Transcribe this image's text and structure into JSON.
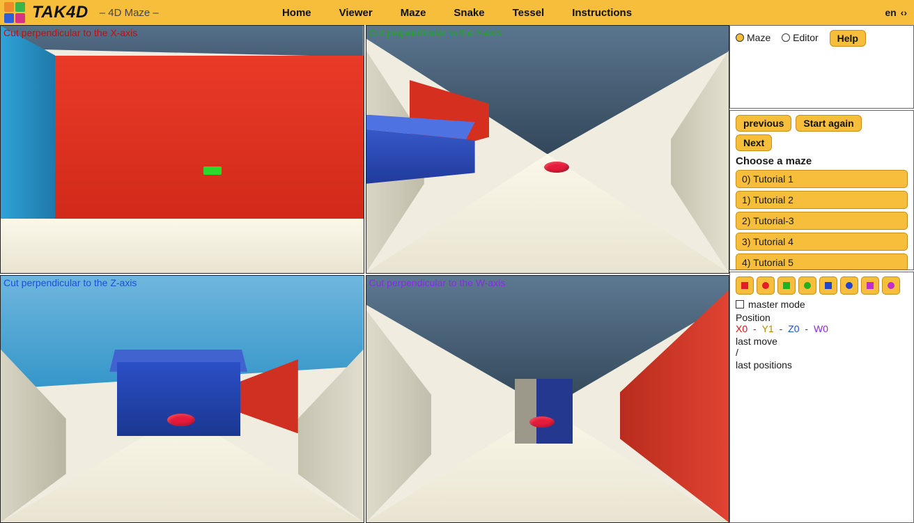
{
  "brand": "TAK4D",
  "subtitle": "– 4D Maze –",
  "nav": {
    "home": "Home",
    "viewer": "Viewer",
    "maze": "Maze",
    "snake": "Snake",
    "tessel": "Tessel",
    "instructions": "Instructions"
  },
  "lang": {
    "label": "en",
    "icon": "‹›"
  },
  "panes": {
    "x": "Cut perpendicular to the X-axis",
    "y": "Cut perpendicular to the Y-axis",
    "z": "Cut perpendicular to the Z-axis",
    "w": "Cut perpendicular to the W-axis"
  },
  "panel_top": {
    "mode_maze": "Maze",
    "mode_editor": "Editor",
    "help": "Help"
  },
  "panel_mid": {
    "previous": "previous",
    "start_again": "Start again",
    "next": "Next",
    "choose": "Choose a maze",
    "items": {
      "0": "0) Tutorial 1",
      "1": "1) Tutorial 2",
      "2": "2) Tutorial-3",
      "3": "3) Tutorial 4",
      "4": "4) Tutorial 5"
    }
  },
  "panel_bot": {
    "master_mode": "master mode",
    "position_label": "Position",
    "pos": {
      "x": "X0",
      "y": "Y1",
      "z": "Z0",
      "w": "W0",
      "sep": " - "
    },
    "last_move_label": "last move",
    "last_move_value": "/",
    "last_positions_label": "last positions",
    "shape_colors": {
      "0": "#e61b2a",
      "1": "#e61b2a",
      "2": "#1fb11f",
      "3": "#1fb11f",
      "4": "#2244cc",
      "5": "#2244cc",
      "6": "#c22bd0",
      "7": "#c22bd0"
    }
  }
}
